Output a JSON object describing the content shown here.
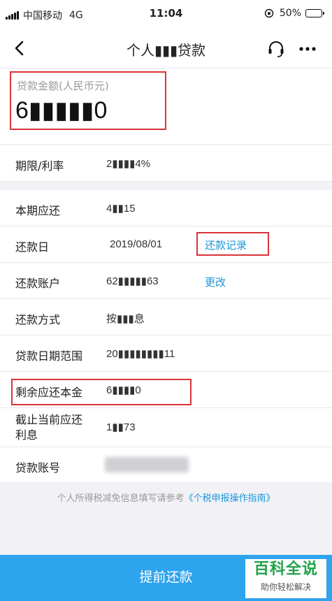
{
  "status_bar": {
    "carrier": "中国移动",
    "network": "4G",
    "time": "11:04",
    "battery_percent": "50%",
    "battery_level": 0.5
  },
  "nav": {
    "title": "个人▮▮▮贷款",
    "back_icon": "chevron-left-icon",
    "headset_icon": "headset-icon",
    "more_icon": "more-dots-icon"
  },
  "amount": {
    "label": "贷款金额(人民币元)",
    "value": "6▮▮▮▮▮0"
  },
  "rows": {
    "term_rate": {
      "label": "期限/利率",
      "value": "2▮▮▮▮4%"
    },
    "current_due": {
      "label": "本期应还",
      "value": "4▮▮15"
    },
    "repay_day": {
      "label": "还款日",
      "value": "2019/08/01",
      "link": "还款记录"
    },
    "account": {
      "label": "还款账户",
      "value": "62▮▮▮▮▮63",
      "link": "更改"
    },
    "method": {
      "label": "还款方式",
      "value": "按▮▮▮息"
    },
    "period": {
      "label": "贷款日期范围",
      "value": "20▮▮▮▮▮▮▮▮11"
    },
    "principal": {
      "label": "剩余应还本金",
      "value": "6▮▮▮▮0"
    },
    "interest": {
      "label_line1": "截止当前应还",
      "label_line2": "利息",
      "value": "1▮▮73"
    },
    "loan_no": {
      "label": "贷款账号"
    }
  },
  "footer": {
    "note_prefix": "个人所得税减免信息填写请参考",
    "note_link": "《个税申报操作指南》"
  },
  "button": {
    "prepay_label": "提前还款"
  },
  "watermark": {
    "title": "百科全说",
    "subtitle": "助你轻松解决"
  },
  "colors": {
    "accent": "#2ea3ee",
    "link": "#1a95d8",
    "highlight": "#d9333a",
    "watermark": "#21a24a"
  }
}
